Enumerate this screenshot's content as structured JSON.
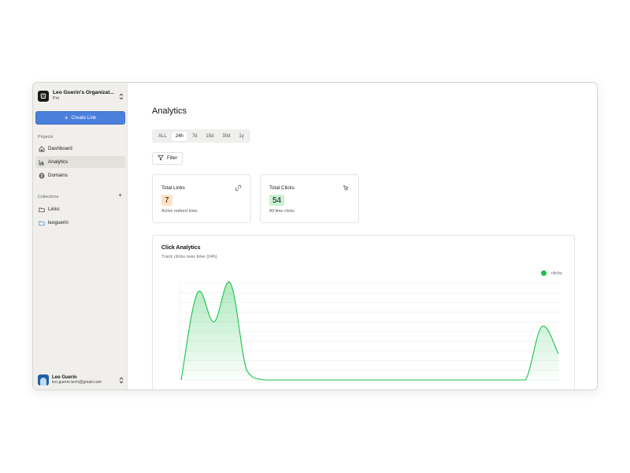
{
  "org": {
    "name": "Leo Guerin's Organizat...",
    "plan": "Pro"
  },
  "sidebar": {
    "create_label": "Create Link",
    "projects_label": "Projects",
    "nav": [
      {
        "label": "Dashboard",
        "icon": "home-icon"
      },
      {
        "label": "Analytics",
        "icon": "bar-chart-icon",
        "active": true
      },
      {
        "label": "Domains",
        "icon": "globe-icon"
      }
    ],
    "collections_label": "Collections",
    "collections": [
      {
        "label": "Links",
        "icon": "folder-icon"
      },
      {
        "label": "leoguerin",
        "icon": "folder-icon",
        "color": "#3b82c4"
      }
    ]
  },
  "user": {
    "name": "Leo Guerin",
    "email": "leo.guerin.tech@gmail.com"
  },
  "main": {
    "title": "Analytics",
    "tabs": [
      {
        "label": "ALL"
      },
      {
        "label": "24h",
        "active": true
      },
      {
        "label": "7d"
      },
      {
        "label": "15d"
      },
      {
        "label": "30d"
      },
      {
        "label": "1y"
      }
    ],
    "filter_label": "Filter"
  },
  "cards": {
    "total_links": {
      "title": "Total Links",
      "value": "7",
      "sub": "Active redirect links",
      "icon": "link-icon",
      "badge_color": "#fde2c4"
    },
    "total_clicks": {
      "title": "Total Clicks",
      "value": "54",
      "sub": "All time clicks",
      "icon": "cursor-icon",
      "badge_color": "#c9f2d3"
    }
  },
  "chart": {
    "title": "Click Analytics",
    "subtitle": "Track clicks over time (24h)",
    "legend": "clicks",
    "color": "#19c24a"
  },
  "chart_data": {
    "type": "area",
    "title": "Click Analytics",
    "series": [
      {
        "name": "clicks",
        "values": [
          0,
          9,
          6,
          10,
          1,
          0,
          0,
          0,
          0,
          0,
          0,
          0,
          0,
          0,
          0,
          0,
          0,
          0,
          0,
          0,
          0,
          0,
          5.5,
          2.7
        ]
      }
    ],
    "ylim": [
      0,
      10
    ],
    "grid": true,
    "legend_position": "top-right"
  }
}
